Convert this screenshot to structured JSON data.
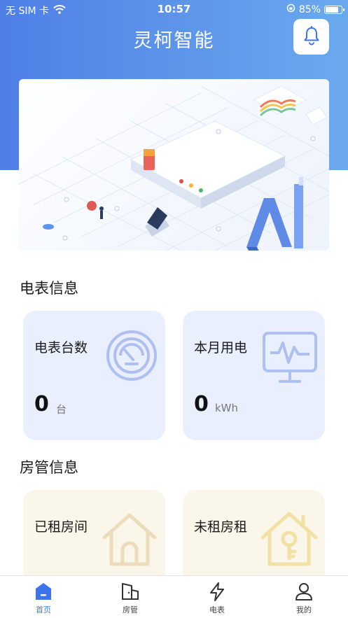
{
  "status_bar": {
    "carrier": "无 SIM 卡",
    "time": "10:57",
    "battery": "85%",
    "battery_level": 0.85
  },
  "header": {
    "title": "灵柯智能"
  },
  "meter_section": {
    "title": "电表信息",
    "cards": [
      {
        "label": "电表台数",
        "value": "0",
        "unit": "台",
        "icon": "meter-gauge-icon"
      },
      {
        "label": "本月用电",
        "value": "0",
        "unit": "kWh",
        "icon": "monitor-pulse-icon"
      }
    ]
  },
  "room_section": {
    "title": "房管信息",
    "cards": [
      {
        "label": "已租房间",
        "icon": "house-icon"
      },
      {
        "label": "未租房租",
        "icon": "house-key-icon"
      }
    ]
  },
  "tabs": [
    {
      "label": "首页",
      "icon": "home-icon",
      "active": true
    },
    {
      "label": "房管",
      "icon": "building-icon",
      "active": false
    },
    {
      "label": "电表",
      "icon": "lightning-icon",
      "active": false
    },
    {
      "label": "我的",
      "icon": "user-icon",
      "active": false
    }
  ],
  "colors": {
    "header_gradient_start": "#4f7fe6",
    "header_gradient_end": "#6aa9ee",
    "accent": "#3d74ee",
    "blue_card": "#e9effc",
    "cream_card": "#fbf6ea"
  }
}
